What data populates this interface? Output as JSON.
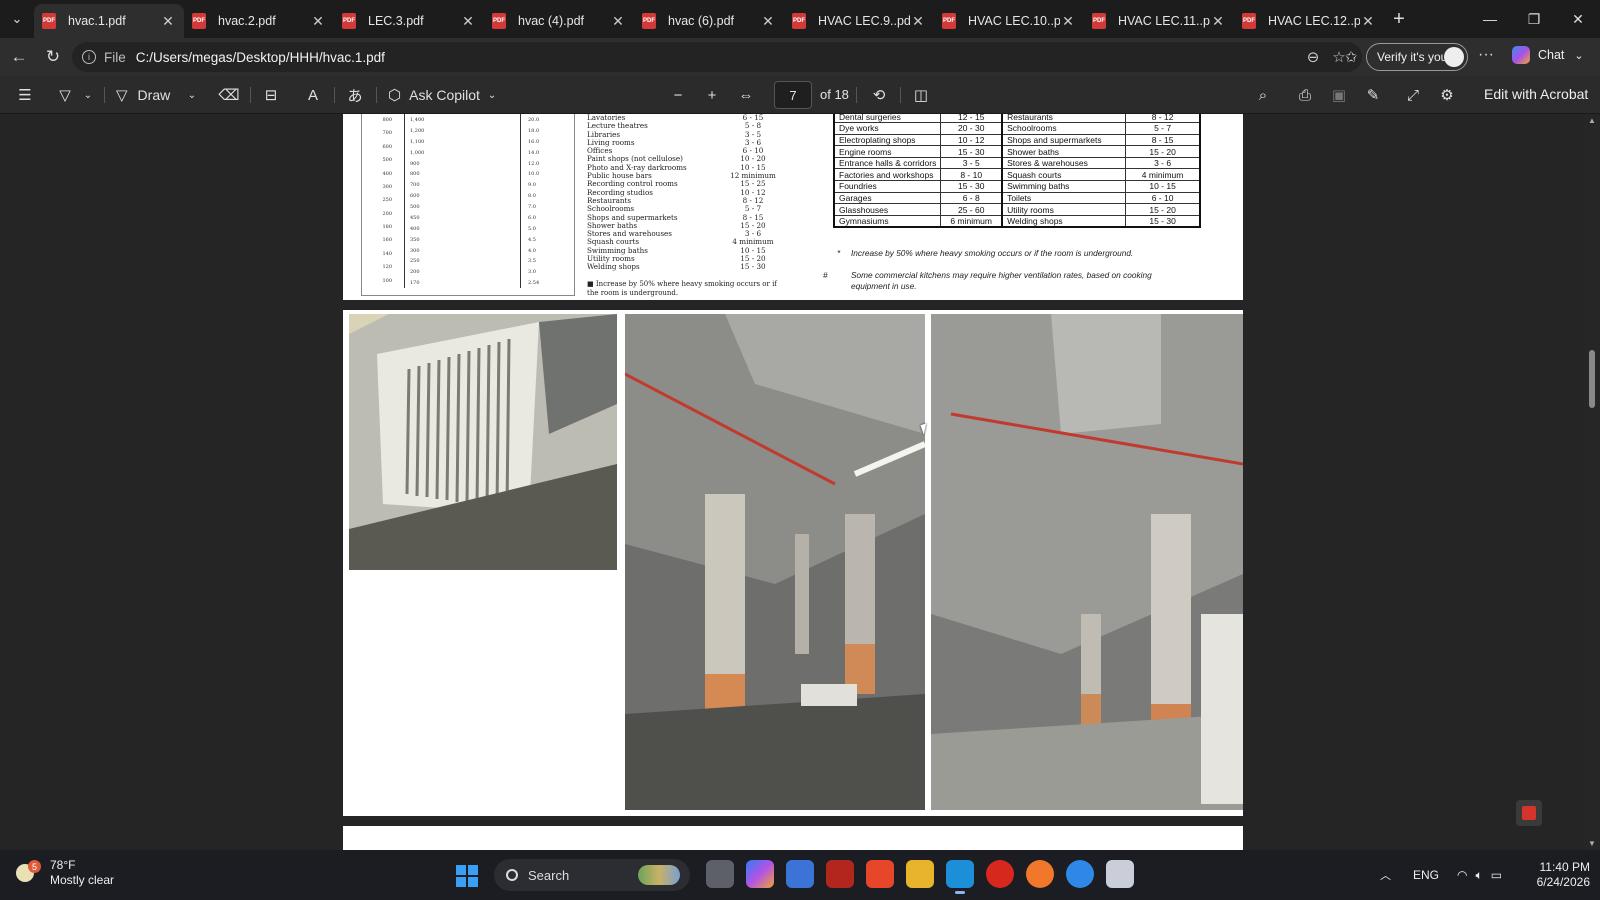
{
  "tabs": [
    {
      "label": "hvac.1.pdf",
      "active": true
    },
    {
      "label": "hvac.2.pdf"
    },
    {
      "label": "LEC.3.pdf"
    },
    {
      "label": "hvac (4).pdf"
    },
    {
      "label": "hvac (6).pdf"
    },
    {
      "label": "HVAC LEC.9..pdf"
    },
    {
      "label": "HVAC LEC.10..pdf"
    },
    {
      "label": "HVAC LEC.11..pdf"
    },
    {
      "label": "HVAC LEC.12..pdf"
    }
  ],
  "address": {
    "scheme": "File",
    "url": "C:/Users/megas/Desktop/HHH/hvac.1.pdf",
    "verify_label": "Verify it's you",
    "chat_label": "Chat"
  },
  "pdf_toolbar": {
    "draw_label": "Draw",
    "copilot_label": "Ask Copilot",
    "page_current": "7",
    "page_total": "of 18",
    "edit_label": "Edit with Acrobat"
  },
  "nomogram": {
    "left_scale": [
      "800",
      "700",
      "600",
      "500",
      "400",
      "300",
      "250",
      "200",
      "180",
      "160",
      "140",
      "120",
      "100"
    ],
    "mid_scale": [
      "1,400",
      "1,200",
      "1,100",
      "1,000",
      "900",
      "800",
      "700",
      "600",
      "500",
      "450",
      "400",
      "350",
      "300",
      "250",
      "200",
      "170"
    ],
    "right_scale": [
      "20.0",
      "18.0",
      "16.0",
      "14.0",
      "12.0",
      "10.0",
      "9.0",
      "8.0",
      "7.0",
      "6.0",
      "5.0",
      "4.5",
      "4.0",
      "3.5",
      "3.0",
      "2.54"
    ]
  },
  "rooms_list": [
    {
      "room": "Lavatories",
      "value": "6 - 15"
    },
    {
      "room": "Lecture theatres",
      "value": "5 - 8"
    },
    {
      "room": "Libraries",
      "value": "3 - 5"
    },
    {
      "room": "Living rooms",
      "value": "3 - 6"
    },
    {
      "room": "Offices",
      "value": "6 - 10"
    },
    {
      "room": "Paint shops (not cellulose)",
      "value": "10 - 20"
    },
    {
      "room": "Photo and X-ray darkrooms",
      "value": "10 - 15"
    },
    {
      "room": "Public house bars",
      "value": "12 minimum"
    },
    {
      "room": "Recording control rooms",
      "value": "15 - 25"
    },
    {
      "room": "Recording studios",
      "value": "10 - 12"
    },
    {
      "room": "Restaurants",
      "value": "8 - 12"
    },
    {
      "room": "Schoolrooms",
      "value": "5 - 7"
    },
    {
      "room": "Shops and supermarkets",
      "value": "8 - 15"
    },
    {
      "room": "Shower baths",
      "value": "15 - 20"
    },
    {
      "room": "Stores and warehouses",
      "value": "3 - 6"
    },
    {
      "room": "Squash courts",
      "value": "4 minimum"
    },
    {
      "room": "Swimming baths",
      "value": "10 - 15"
    },
    {
      "room": "Utility rooms",
      "value": "15 - 20"
    },
    {
      "room": "Welding shops",
      "value": "15 - 30"
    }
  ],
  "rooms_note": "■ Increase by 50% where heavy smoking occurs or if the room is underground.",
  "ach_table": [
    [
      "Dental surgeries",
      "12 - 15",
      "Restaurants",
      "8 - 12"
    ],
    [
      "Dye works",
      "20 - 30",
      "Schoolrooms",
      "5 - 7"
    ],
    [
      "Electroplating shops",
      "10 - 12",
      "Shops and supermarkets",
      "8 - 15"
    ],
    [
      "Engine rooms",
      "15 - 30",
      "Shower baths",
      "15 - 20"
    ],
    [
      "Entrance halls & corridors",
      "3 - 5",
      "Stores & warehouses",
      "3 - 6"
    ],
    [
      "Factories and workshops",
      "8 - 10",
      "Squash courts",
      "4 minimum"
    ],
    [
      "Foundries",
      "15 - 30",
      "Swimming baths",
      "10 - 15"
    ],
    [
      "Garages",
      "6 - 8",
      "Toilets",
      "6 - 10"
    ],
    [
      "Glasshouses",
      "25 - 60",
      "Utility rooms",
      "15 - 20"
    ],
    [
      "Gymnasiums",
      "6 minimum",
      "Welding shops",
      "15 - 30"
    ]
  ],
  "footnotes": [
    {
      "mark": "*",
      "text": "Increase by 50% where heavy smoking occurs or if the room is underground."
    },
    {
      "mark": "#",
      "text": "Some commercial kitchens may require higher ventilation rates, based on cooking equipment   in use."
    }
  ],
  "taskbar": {
    "temp": "78°F",
    "weather": "Mostly clear",
    "weather_badge": "5",
    "search_label": "Search",
    "lang": "ENG",
    "time": "11:40 PM",
    "date": "6/24/2026"
  },
  "colors": {
    "tab_pdf": "#d23a3a",
    "accent_blue": "#3aa0f5"
  }
}
